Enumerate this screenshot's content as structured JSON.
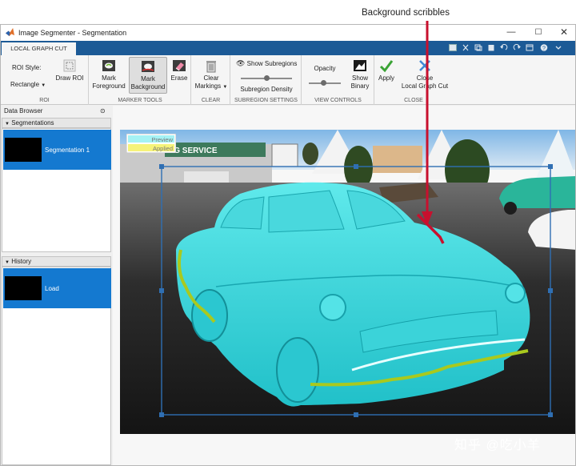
{
  "annotation": {
    "label": "Background scribbles"
  },
  "window": {
    "title": "Image Segmenter - Segmentation",
    "controls": {
      "minimize": "—",
      "maximize": "☐",
      "close": "✕"
    }
  },
  "ribbon_tab": {
    "label": "LOCAL GRAPH CUT"
  },
  "ribbon": {
    "roi": {
      "style_label": "ROI Style:",
      "shape_value": "Rectangle",
      "draw_roi": "Draw ROI",
      "group": "ROI"
    },
    "marker_tools": {
      "mark_foreground": [
        "Mark",
        "Foreground"
      ],
      "mark_background": [
        "Mark",
        "Background"
      ],
      "erase": "Erase",
      "group": "MARKER TOOLS"
    },
    "clear": {
      "clear_markings": [
        "Clear",
        "Markings"
      ],
      "group": "CLEAR"
    },
    "subregion": {
      "show_subregions": "Show Subregions",
      "density": "Subregion Density",
      "group": "SUBREGION SETTINGS",
      "density_level": 0.5
    },
    "view_controls": {
      "opacity": "Opacity",
      "show_binary": [
        "Show",
        "Binary"
      ],
      "group": "VIEW CONTROLS",
      "opacity_level": 0.45
    },
    "close_group": {
      "apply": "Apply",
      "close_local_graph_cut": [
        "Close",
        "Local Graph Cut"
      ],
      "group": "CLOSE"
    }
  },
  "left_panel": {
    "header": "Data Browser",
    "segmentations": {
      "title": "Segmentations",
      "items": [
        "Segmentation 1"
      ]
    },
    "history": {
      "title": "History",
      "items": [
        "Load"
      ]
    }
  },
  "legend": {
    "preview": "Preview",
    "applied": "Applied"
  },
  "scene": {
    "sign_text": "NG SERVICE"
  },
  "watermark": "知乎 @吃小羊",
  "colors": {
    "accent": "#1479d0",
    "tabstrip": "#1c5a96",
    "preview": "#2fe0e6",
    "scribble_fg": "#a9c91e",
    "scribble_bg": "#c8102e",
    "roi_box": "#2f6fb3"
  }
}
